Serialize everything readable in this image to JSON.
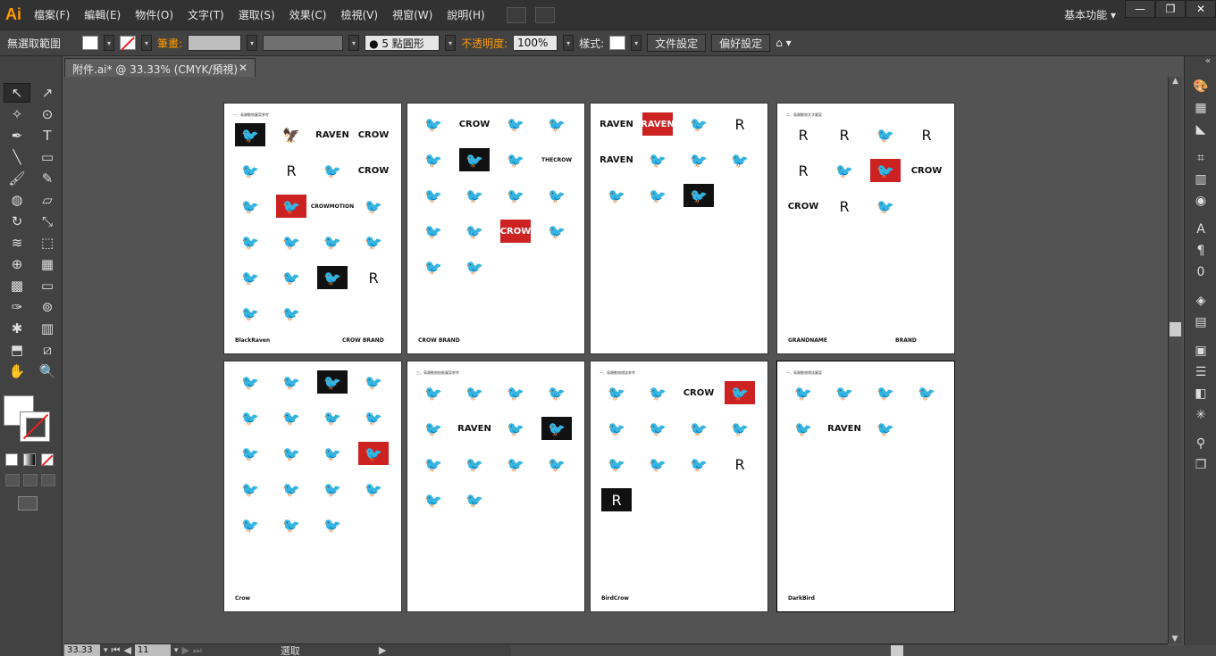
{
  "app": {
    "logo": "Ai",
    "workspace": "基本功能 ▾"
  },
  "menu": [
    "檔案(F)",
    "編輯(E)",
    "物件(O)",
    "文字(T)",
    "選取(S)",
    "效果(C)",
    "檢視(V)",
    "視窗(W)",
    "說明(H)"
  ],
  "window_buttons": {
    "minimize": "—",
    "restore": "❐",
    "close": "✕"
  },
  "control": {
    "selection_label": "無選取範圍",
    "stroke_label": "筆畫:",
    "brush_value": "● 5 點圓形",
    "opacity_label": "不透明度:",
    "opacity_value": "100%",
    "style_label": "樣式:",
    "doc_setup": "文件設定",
    "preferences": "偏好設定"
  },
  "document": {
    "tab_title": "附件.ai* @ 33.33% (CMYK/預視)",
    "tab_close": "✕"
  },
  "status": {
    "zoom": "33.33",
    "artboard": "11",
    "mode": "選取"
  },
  "tools": [
    "selection-icon",
    "direct-selection-icon",
    "magic-wand-icon",
    "lasso-icon",
    "pen-icon",
    "type-icon",
    "line-icon",
    "rectangle-icon",
    "paintbrush-icon",
    "pencil-icon",
    "blob-brush-icon",
    "eraser-icon",
    "rotate-icon",
    "scale-icon",
    "width-icon",
    "free-transform-icon",
    "shape-builder-icon",
    "perspective-icon",
    "mesh-icon",
    "gradient-icon",
    "eyedropper-icon",
    "blend-icon",
    "symbol-sprayer-icon",
    "graph-icon",
    "artboard-icon",
    "slice-icon",
    "hand-icon",
    "zoom-icon"
  ],
  "pages": [
    {
      "hdr": "一、鳥類動物圖案參考",
      "logos": [
        "🐦",
        "🦅",
        "RAVEN",
        "CROW",
        "🐦",
        "R",
        "🐦",
        "CROW",
        "🐦",
        "🐦",
        "CROWMOTION",
        "🐦",
        "🐦",
        "🐦",
        "🐦",
        "🐦",
        "🐦",
        "🐦",
        "🐦",
        "R",
        "🐦",
        "🐦"
      ],
      "texts": [
        "BlackRaven",
        "CROW BRAND"
      ]
    },
    {
      "hdr": "",
      "logos": [
        "🐦",
        "CROW",
        "🐦",
        "🐦",
        "🐦",
        "🐦",
        "🐦",
        "THECROW",
        "🐦",
        "🐦",
        "🐦",
        "🐦",
        "🐦",
        "🐦",
        "CROW",
        "🐦",
        "🐦",
        "🐦"
      ],
      "texts": [
        "CROW BRAND"
      ]
    },
    {
      "hdr": "",
      "logos": [
        "RAVEN",
        "RAVEN",
        "🐦",
        "R",
        "RAVEN",
        "🐦",
        "🐦",
        "🐦",
        "🐦",
        "🐦",
        "🐦"
      ],
      "texts": []
    },
    {
      "hdr": "二、鳥類動物文字圖案",
      "logos": [
        "R",
        "R",
        "🐦",
        "R",
        "R",
        "🐦",
        "🐦",
        "CROW",
        "CROW",
        "R",
        "🐦"
      ],
      "texts": [
        "GRANDNAME",
        "BRAND"
      ]
    },
    {
      "hdr": "",
      "logos": [
        "🐦",
        "🐦",
        "🐦",
        "🐦",
        "🐦",
        "🐦",
        "🐦",
        "🐦",
        "🐦",
        "🐦",
        "🐦",
        "🐦",
        "🐦",
        "🐦",
        "🐦",
        "🐦",
        "🐦",
        "🐦",
        "🐦"
      ],
      "texts": [
        "Crow"
      ]
    },
    {
      "hdr": "三、鳥類動物抽象圖案參考",
      "logos": [
        "🐦",
        "🐦",
        "🐦",
        "🐦",
        "🐦",
        "RAVEN",
        "🐦",
        "🐦",
        "🐦",
        "🐦",
        "🐦",
        "🐦",
        "🐦",
        "🐦"
      ],
      "texts": []
    },
    {
      "hdr": "一、鳥類動物標誌參考",
      "logos": [
        "🐦",
        "🐦",
        "CROW",
        "🐦",
        "🐦",
        "🐦",
        "🐦",
        "🐦",
        "🐦",
        "🐦",
        "🐦",
        "R",
        "R"
      ],
      "texts": [
        "BirdCrow"
      ]
    },
    {
      "hdr": "一、鳥類動物標誌圖案",
      "logos": [
        "🐦",
        "🐦",
        "🐦",
        "🐦",
        "🐦",
        "RAVEN",
        "🐦"
      ],
      "texts": [
        "DarkBird"
      ]
    }
  ],
  "colors": {
    "accent": "#ff9a00",
    "bg": "#535353",
    "panel": "#424242"
  }
}
